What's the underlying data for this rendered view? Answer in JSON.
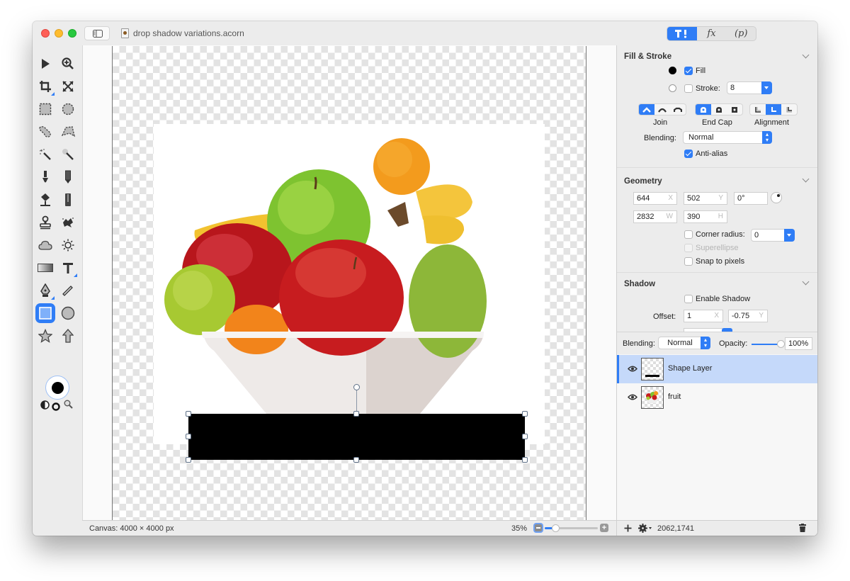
{
  "window": {
    "title": "drop shadow variations.acorn",
    "inspector_tabs": [
      {
        "label": "tools-icon",
        "active": true
      },
      {
        "label": "fx",
        "active": false
      },
      {
        "label": "(p)",
        "active": false
      }
    ]
  },
  "tools": [
    "select-arrow",
    "zoom",
    "crop",
    "transform",
    "rect-marquee",
    "ellipse-marquee",
    "lasso",
    "polygon-lasso",
    "magic-wand",
    "color-wand",
    "brush",
    "pencil",
    "paint-bucket",
    "gradient-fill-tool",
    "clone-stamp",
    "smudge",
    "cloud-shape",
    "sun-burn",
    "gradient",
    "text",
    "bezier-pen",
    "line",
    "rectangle",
    "oval",
    "star",
    "arrow"
  ],
  "selected_tool": "rectangle",
  "colors": {
    "accent": "#2f7df6",
    "fill_color": "#000000",
    "stroke_color": "#ffffff",
    "selected_row": "#c5d9fa"
  },
  "fill_stroke": {
    "title": "Fill & Stroke",
    "fill_label": "Fill",
    "fill_checked": true,
    "stroke_label": "Stroke:",
    "stroke_checked": false,
    "stroke_width": "8",
    "join_label": "Join",
    "endcap_label": "End Cap",
    "alignment_label": "Alignment",
    "blending_label": "Blending:",
    "blending_value": "Normal",
    "antialias_label": "Anti-alias",
    "antialias_checked": true
  },
  "geometry": {
    "title": "Geometry",
    "x": "644",
    "x_unit": "X",
    "y": "502",
    "y_unit": "Y",
    "angle": "0°",
    "w": "2832",
    "w_unit": "W",
    "h": "390",
    "h_unit": "H",
    "corner_radius_label": "Corner radius:",
    "corner_radius_value": "0",
    "superellipse_label": "Superellipse",
    "snap_label": "Snap to pixels"
  },
  "shadow": {
    "title": "Shadow",
    "enable_label": "Enable Shadow",
    "enabled": false,
    "offset_label": "Offset:",
    "offset_x": "1",
    "offset_x_unit": "X",
    "offset_y": "-0.75",
    "offset_y_unit": "Y"
  },
  "layers_bar": {
    "blending_label": "Blending:",
    "blending_value": "Normal",
    "opacity_label": "Opacity:",
    "opacity_value": "100%",
    "opacity_fraction": 1.0
  },
  "layers": [
    {
      "name": "Shape Layer",
      "visible": true,
      "selected": true
    },
    {
      "name": "fruit",
      "visible": true,
      "selected": false
    }
  ],
  "status": {
    "canvas_size": "Canvas: 4000 × 4000 px",
    "zoom": "35%",
    "zoom_fraction": 0.2,
    "coordinates": "2062,1741"
  }
}
